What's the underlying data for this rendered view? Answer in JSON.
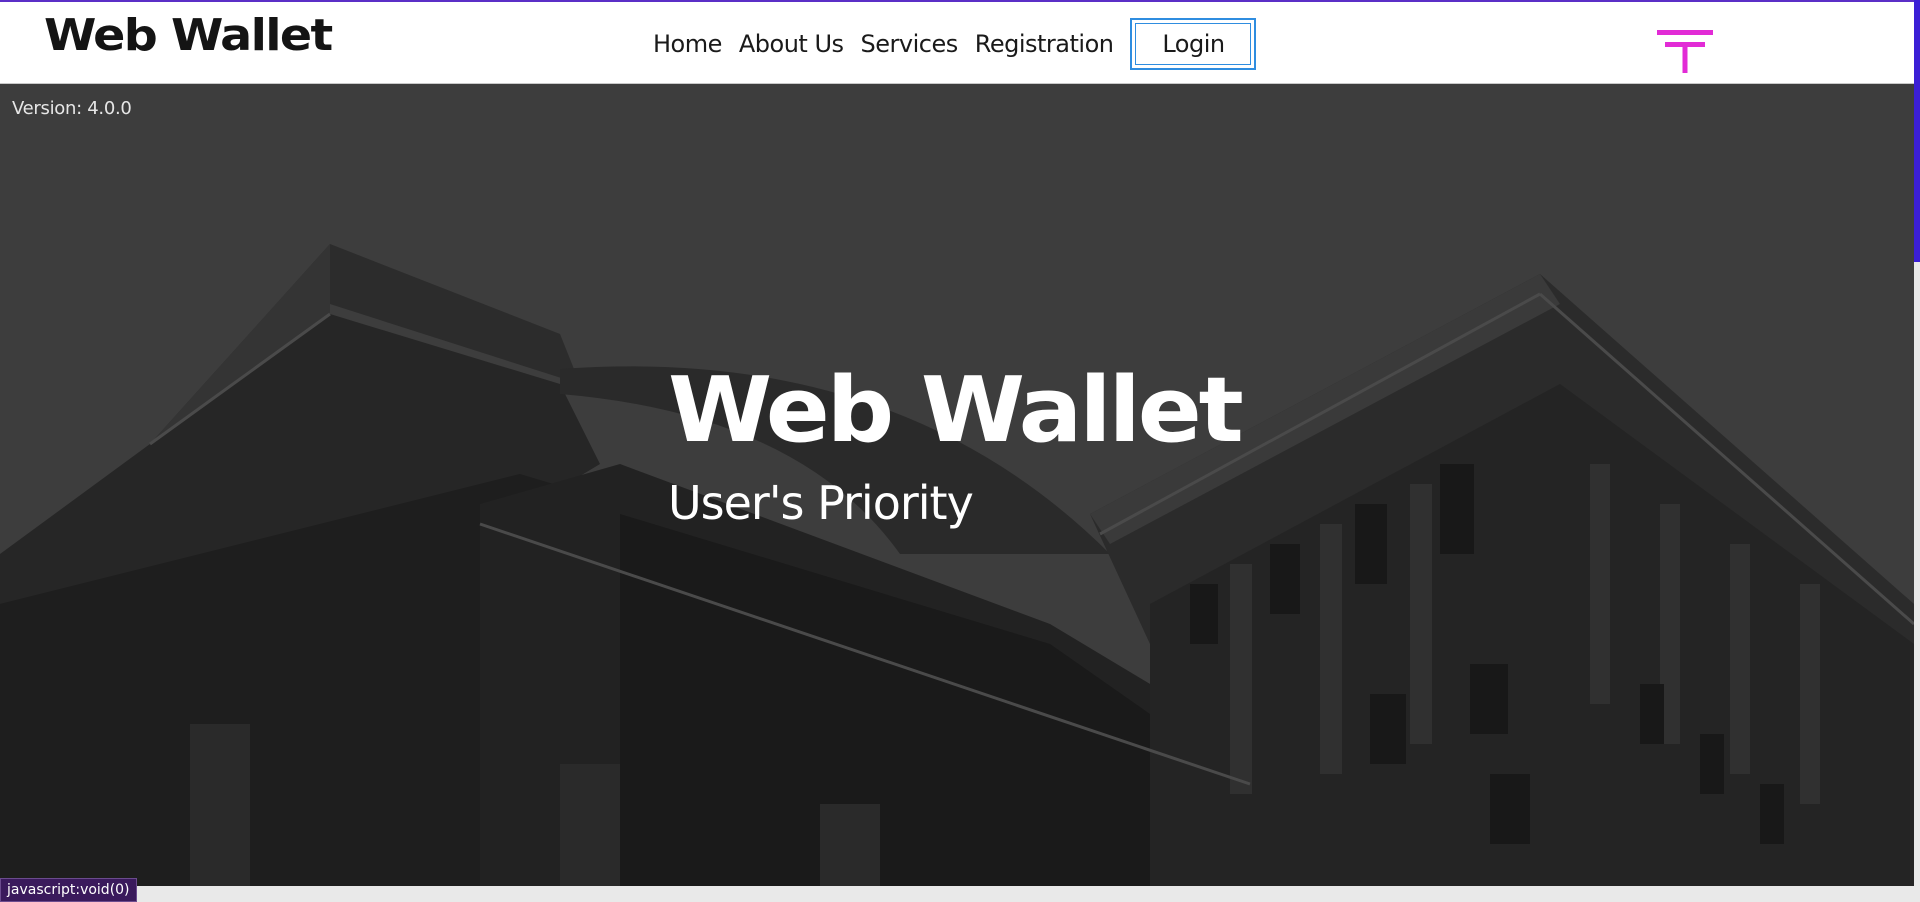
{
  "header": {
    "brand": "Web Wallet",
    "nav": [
      "Home",
      "About Us",
      "Services",
      "Registration"
    ],
    "login_label": "Login",
    "logo_icon": "yen-symbol-icon",
    "accent_color": "#e22bd6"
  },
  "hero": {
    "version": "Version: 4.0.0",
    "title": "Web Wallet",
    "subtitle": "User's Priority",
    "background": "building-photo"
  },
  "status_bar": {
    "url": "javascript:void(0)"
  }
}
